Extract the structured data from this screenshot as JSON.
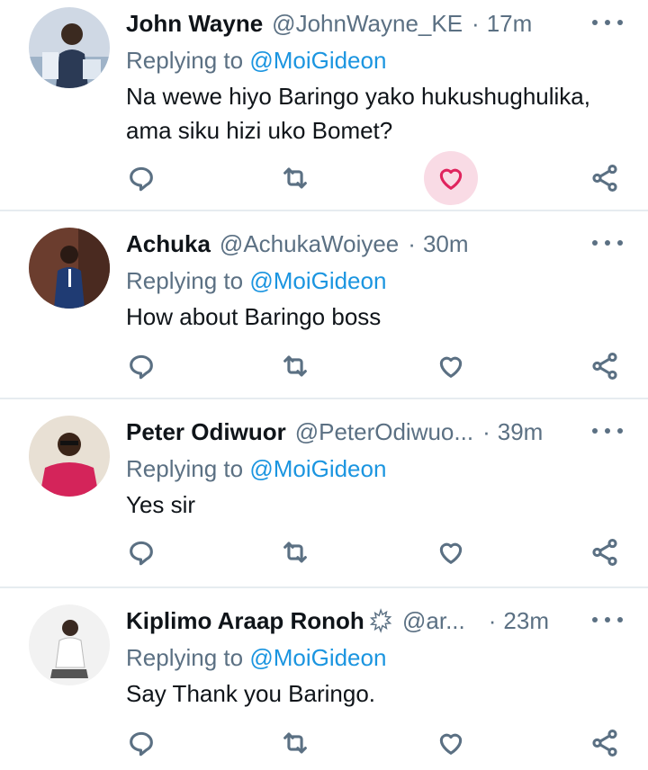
{
  "tweets": [
    {
      "name": "John Wayne",
      "handle": "@JohnWayne_KE",
      "dot": "·",
      "time": "17m",
      "replying_prefix": "Replying to ",
      "mention": "@MoiGideon",
      "text_lines": [
        "Na wewe hiyo Baringo yako hukushughulika,",
        "ama siku hizi uko Bomet?"
      ],
      "liked": true,
      "avatar_colors": [
        "#cfd8e4",
        "#2b3a55"
      ]
    },
    {
      "name": "Achuka",
      "handle": "@AchukaWoiyee",
      "dot": "·",
      "time": "30m",
      "replying_prefix": "Replying to ",
      "mention": "@MoiGideon",
      "text_lines": [
        "How about Baringo boss"
      ],
      "liked": false,
      "avatar_colors": [
        "#6b3d2e",
        "#1f3b73"
      ]
    },
    {
      "name": "Peter Odiwuor",
      "handle": "@PeterOdiwuo...",
      "dot": "·",
      "time": "39m",
      "replying_prefix": "Replying to ",
      "mention": "@MoiGideon",
      "text_lines": [
        "Yes sir"
      ],
      "liked": false,
      "avatar_colors": [
        "#e8e0d4",
        "#d4245a"
      ]
    },
    {
      "name": "Kiplimo Araap Ronoh",
      "handle": "@ar...",
      "dot": "·",
      "time": "23m",
      "replying_prefix": "Replying to ",
      "mention": "@MoiGideon",
      "text_lines": [
        "Say Thank you Baringo."
      ],
      "liked": false,
      "has_badge": true,
      "avatar_colors": [
        "#f2f2f2",
        "#3a2a22"
      ]
    }
  ],
  "colors": {
    "muted": "#5b7083",
    "link": "#1b95e0",
    "like": "#e0245e",
    "like_bg": "#f9dbe5",
    "divider": "#e6ecf0"
  },
  "icons": {
    "reply": "reply-icon",
    "retweet": "retweet-icon",
    "like": "heart-icon",
    "share": "share-icon",
    "more": "more-icon"
  }
}
